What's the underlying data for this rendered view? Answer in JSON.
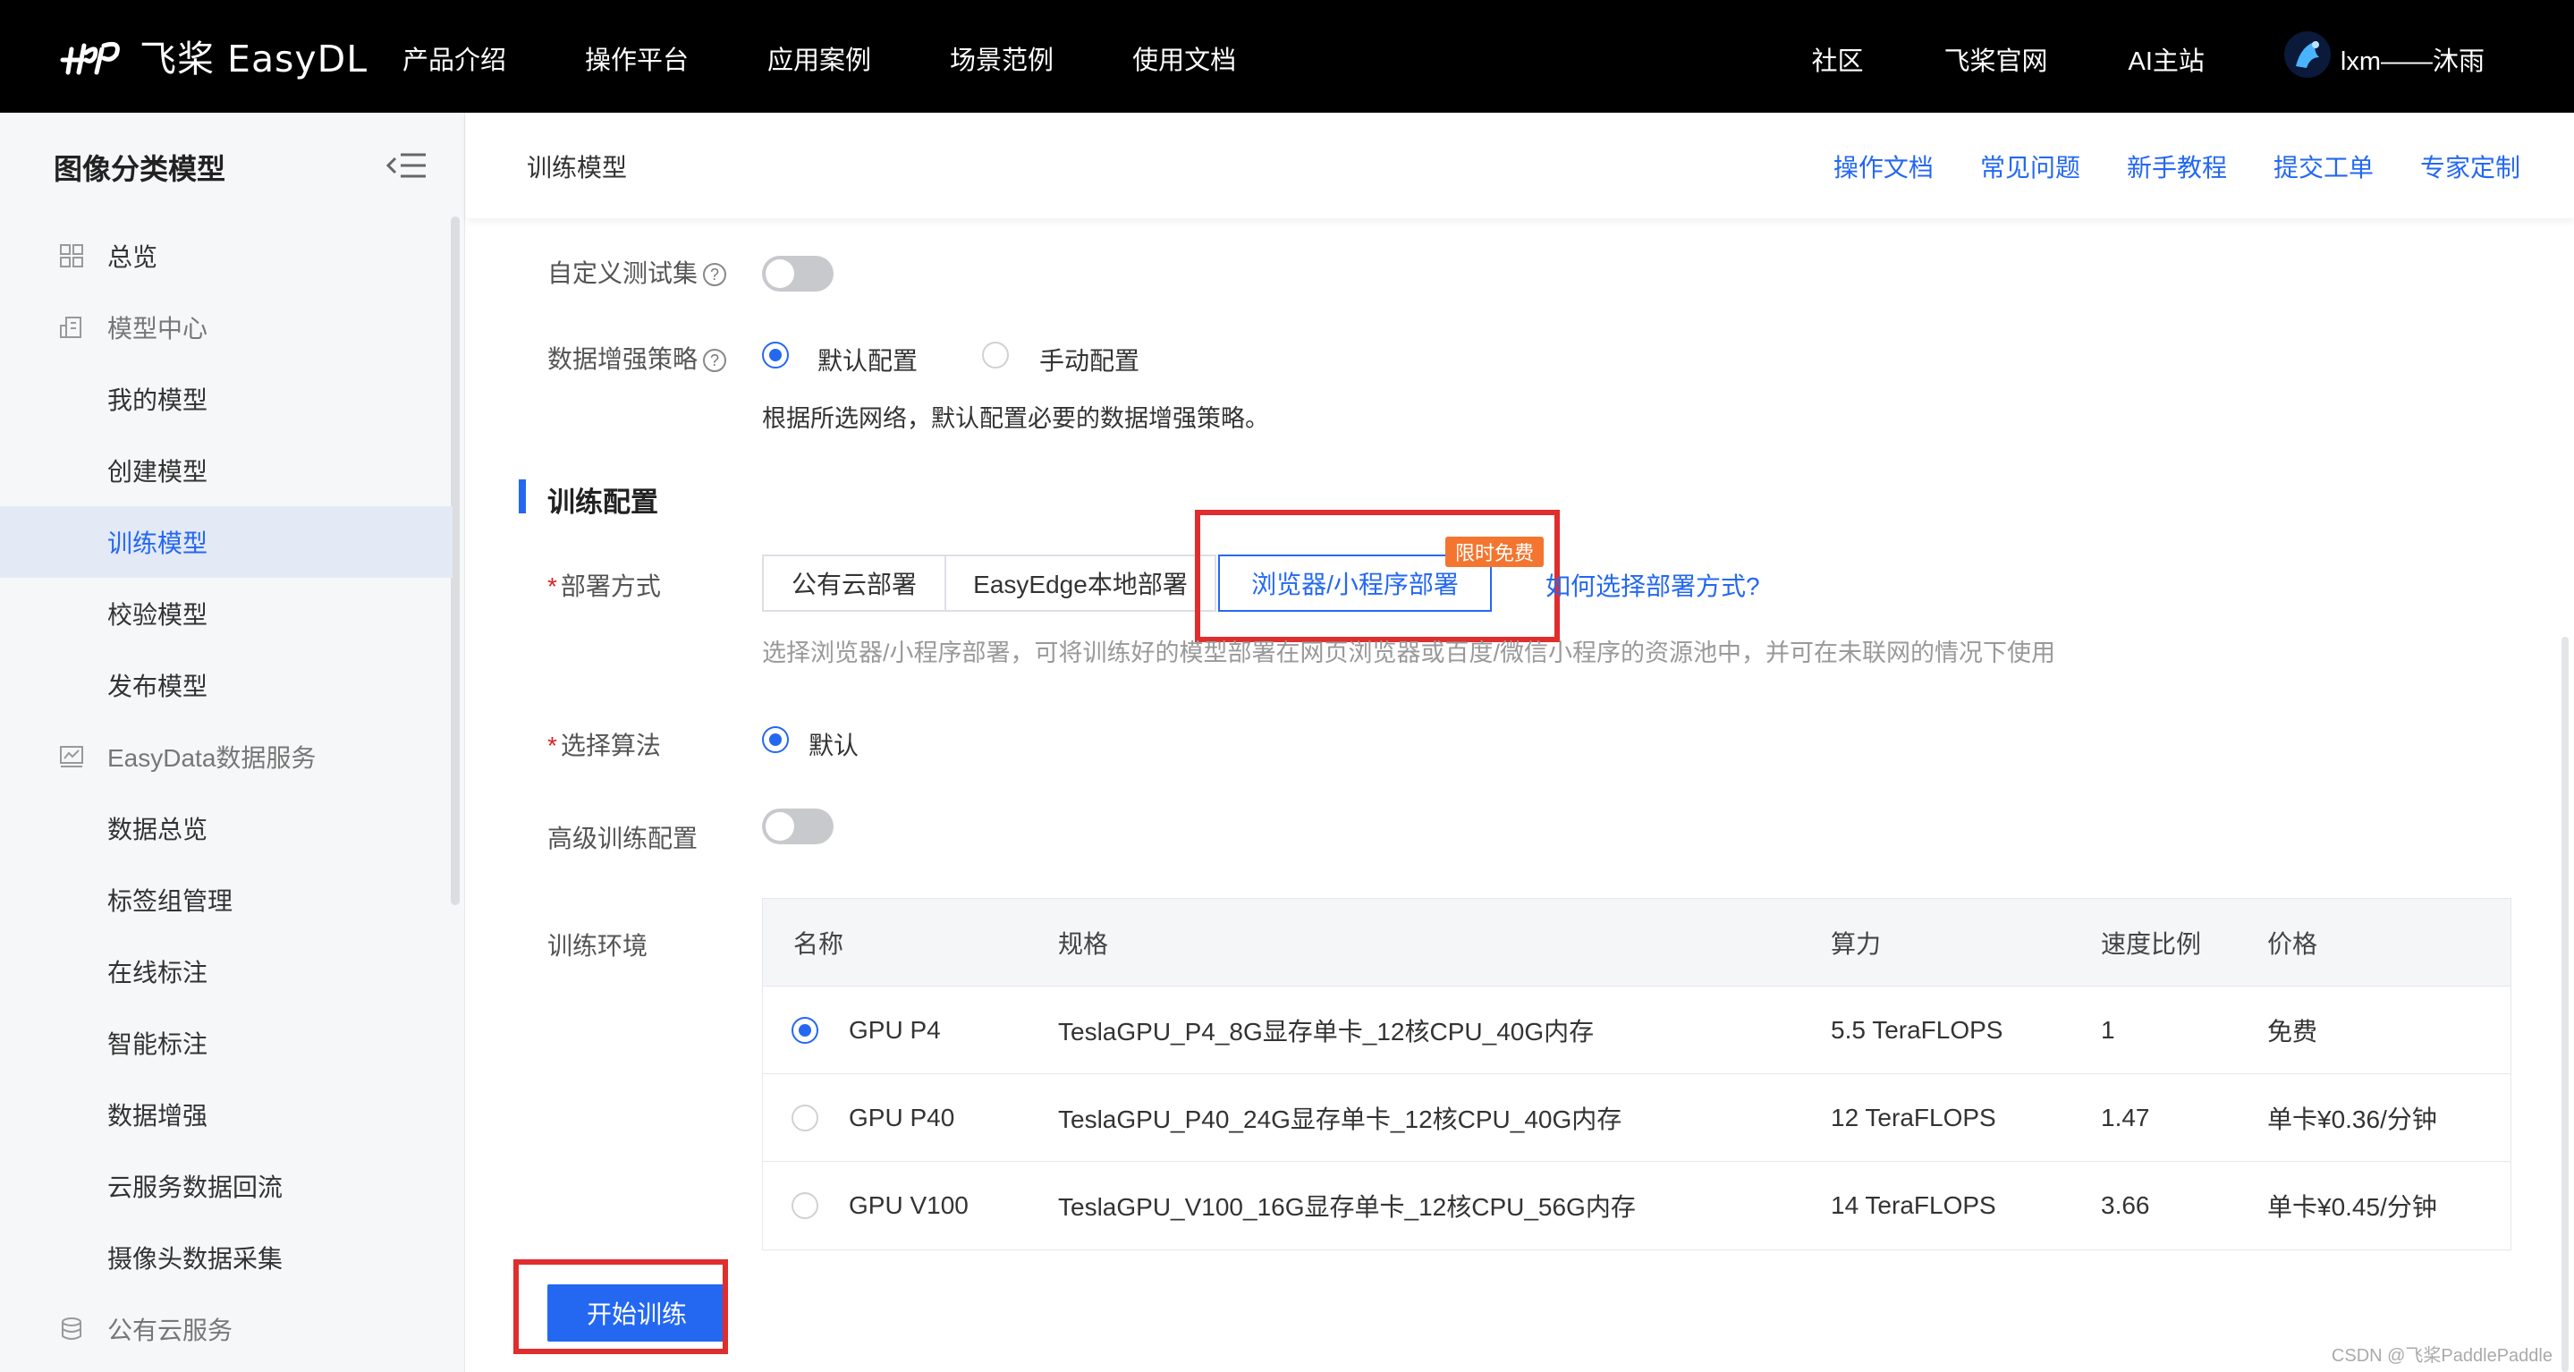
{
  "header": {
    "logo_text": "飞桨 EasyDL",
    "nav": [
      "产品介绍",
      "操作平台",
      "应用案例",
      "场景范例",
      "使用文档"
    ],
    "right_links": [
      "社区",
      "飞桨官网",
      "AI主站"
    ],
    "username": "lxm——沐雨"
  },
  "sidebar": {
    "title": "图像分类模型",
    "items": [
      {
        "label": "总览",
        "kind": "group",
        "icon": "grid-icon"
      },
      {
        "label": "模型中心",
        "kind": "group",
        "icon": "building-icon"
      },
      {
        "label": "我的模型",
        "kind": "sub"
      },
      {
        "label": "创建模型",
        "kind": "sub"
      },
      {
        "label": "训练模型",
        "kind": "sub",
        "active": true
      },
      {
        "label": "校验模型",
        "kind": "sub"
      },
      {
        "label": "发布模型",
        "kind": "sub"
      },
      {
        "label": "EasyData数据服务",
        "kind": "group",
        "icon": "chart-icon"
      },
      {
        "label": "数据总览",
        "kind": "sub"
      },
      {
        "label": "标签组管理",
        "kind": "sub"
      },
      {
        "label": "在线标注",
        "kind": "sub"
      },
      {
        "label": "智能标注",
        "kind": "sub"
      },
      {
        "label": "数据增强",
        "kind": "sub"
      },
      {
        "label": "云服务数据回流",
        "kind": "sub"
      },
      {
        "label": "摄像头数据采集",
        "kind": "sub"
      },
      {
        "label": "公有云服务",
        "kind": "group",
        "icon": "database-icon"
      }
    ]
  },
  "subheader": {
    "breadcrumb": "训练模型",
    "links": [
      "操作文档",
      "常见问题",
      "新手教程",
      "提交工单",
      "专家定制"
    ]
  },
  "form": {
    "custom_testset_label": "自定义测试集",
    "custom_testset_on": false,
    "augment_label": "数据增强策略",
    "augment_options": [
      "默认配置",
      "手动配置"
    ],
    "augment_selected": "默认配置",
    "augment_hint": "根据所选网络，默认配置必要的数据增强策略。",
    "section_title": "训练配置",
    "deploy_label": "部署方式",
    "deploy_options": [
      "公有云部署",
      "EasyEdge本地部署",
      "浏览器/小程序部署"
    ],
    "deploy_selected": "浏览器/小程序部署",
    "deploy_badge": "限时免费",
    "deploy_help_link": "如何选择部署方式?",
    "deploy_hint": "选择浏览器/小程序部署，可将训练好的模型部署在网页浏览器或百度/微信小程序的资源池中，并可在未联网的情况下使用",
    "algo_label": "选择算法",
    "algo_option": "默认",
    "advanced_label": "高级训练配置",
    "advanced_on": false,
    "env_label": "训练环境"
  },
  "env_table": {
    "columns": [
      "名称",
      "规格",
      "算力",
      "速度比例",
      "价格"
    ],
    "rows": [
      {
        "name": "GPU P4",
        "spec": "TeslaGPU_P4_8G显存单卡_12核CPU_40G内存",
        "power": "5.5 TeraFLOPS",
        "ratio": "1",
        "price": "免费",
        "selected": true
      },
      {
        "name": "GPU P40",
        "spec": "TeslaGPU_P40_24G显存单卡_12核CPU_40G内存",
        "power": "12 TeraFLOPS",
        "ratio": "1.47",
        "price": "单卡¥0.36/分钟",
        "selected": false
      },
      {
        "name": "GPU V100",
        "spec": "TeslaGPU_V100_16G显存单卡_12核CPU_56G内存",
        "power": "14 TeraFLOPS",
        "ratio": "3.66",
        "price": "单卡¥0.45/分钟",
        "selected": false
      }
    ]
  },
  "start_button": "开始训练",
  "watermark": "CSDN @飞桨PaddlePaddle",
  "colors": {
    "accent": "#2468f2",
    "highlight_box": "#e02d2d",
    "badge": "#f3752f",
    "topbar": "#000000"
  }
}
